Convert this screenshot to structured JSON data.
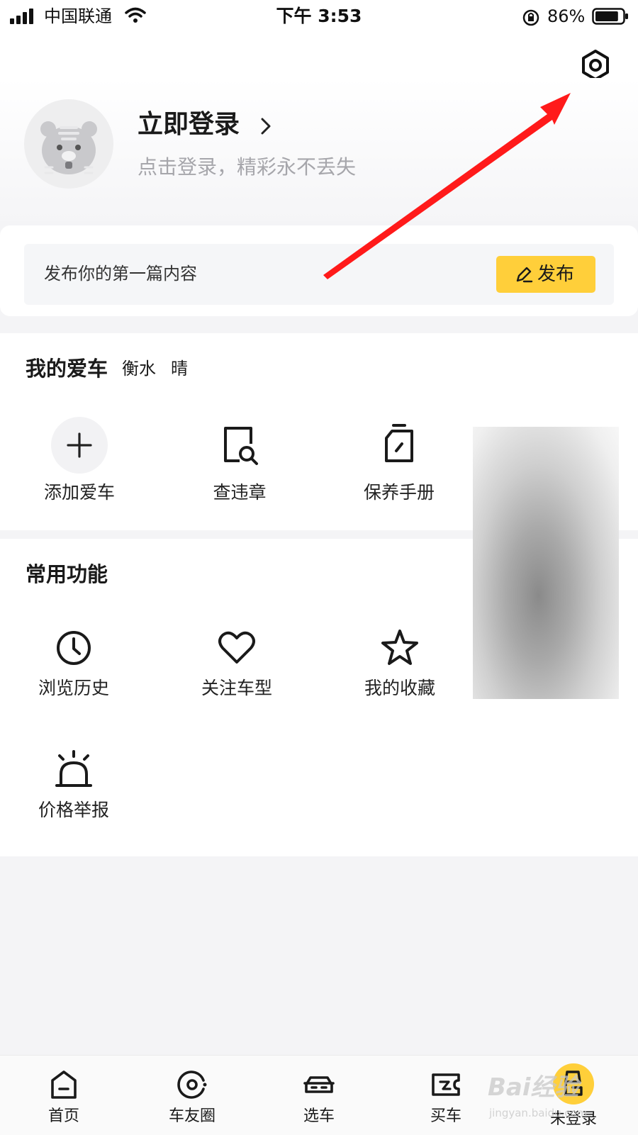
{
  "status_bar": {
    "carrier": "中国联通",
    "time": "下午 3:53",
    "battery_percent": "86%",
    "battery_level": 0.86,
    "icons": [
      "signal-icon",
      "wifi-icon",
      "orientation-lock-icon",
      "battery-icon"
    ]
  },
  "header": {
    "settings_icon": "settings-hexagon-icon"
  },
  "profile": {
    "title": "立即登录",
    "subtitle": "点击登录，精彩永不丢失",
    "avatar_icon": "tiger-avatar-icon"
  },
  "publish": {
    "prompt": "发布你的第一篇内容",
    "button_label": "发布",
    "button_icon": "pencil-icon"
  },
  "my_car": {
    "title": "我的爱车",
    "city": "衡水",
    "weather": "晴",
    "items": [
      {
        "label": "添加爱车",
        "icon": "plus-icon"
      },
      {
        "label": "查违章",
        "icon": "violation-search-icon"
      },
      {
        "label": "保养手册",
        "icon": "maintenance-book-icon"
      }
    ]
  },
  "common_functions": {
    "title": "常用功能",
    "items": [
      {
        "label": "浏览历史",
        "icon": "clock-icon"
      },
      {
        "label": "关注车型",
        "icon": "heart-icon"
      },
      {
        "label": "我的收藏",
        "icon": "star-icon"
      },
      {
        "label": "价格举报",
        "icon": "alarm-light-icon"
      }
    ]
  },
  "tab_bar": {
    "tabs": [
      {
        "label": "首页",
        "icon": "home-icon"
      },
      {
        "label": "车友圈",
        "icon": "circle-icon"
      },
      {
        "label": "选车",
        "icon": "car-icon"
      },
      {
        "label": "买车",
        "icon": "ticket-icon"
      },
      {
        "label": "未登录",
        "icon": "user-icon"
      }
    ]
  },
  "watermark": {
    "text": "Bai经验",
    "sub": "jingyan.baidu.com"
  },
  "colors": {
    "accent": "#ffcf3a",
    "annotation_arrow": "#ff1a1a",
    "background": "#f4f4f6"
  }
}
